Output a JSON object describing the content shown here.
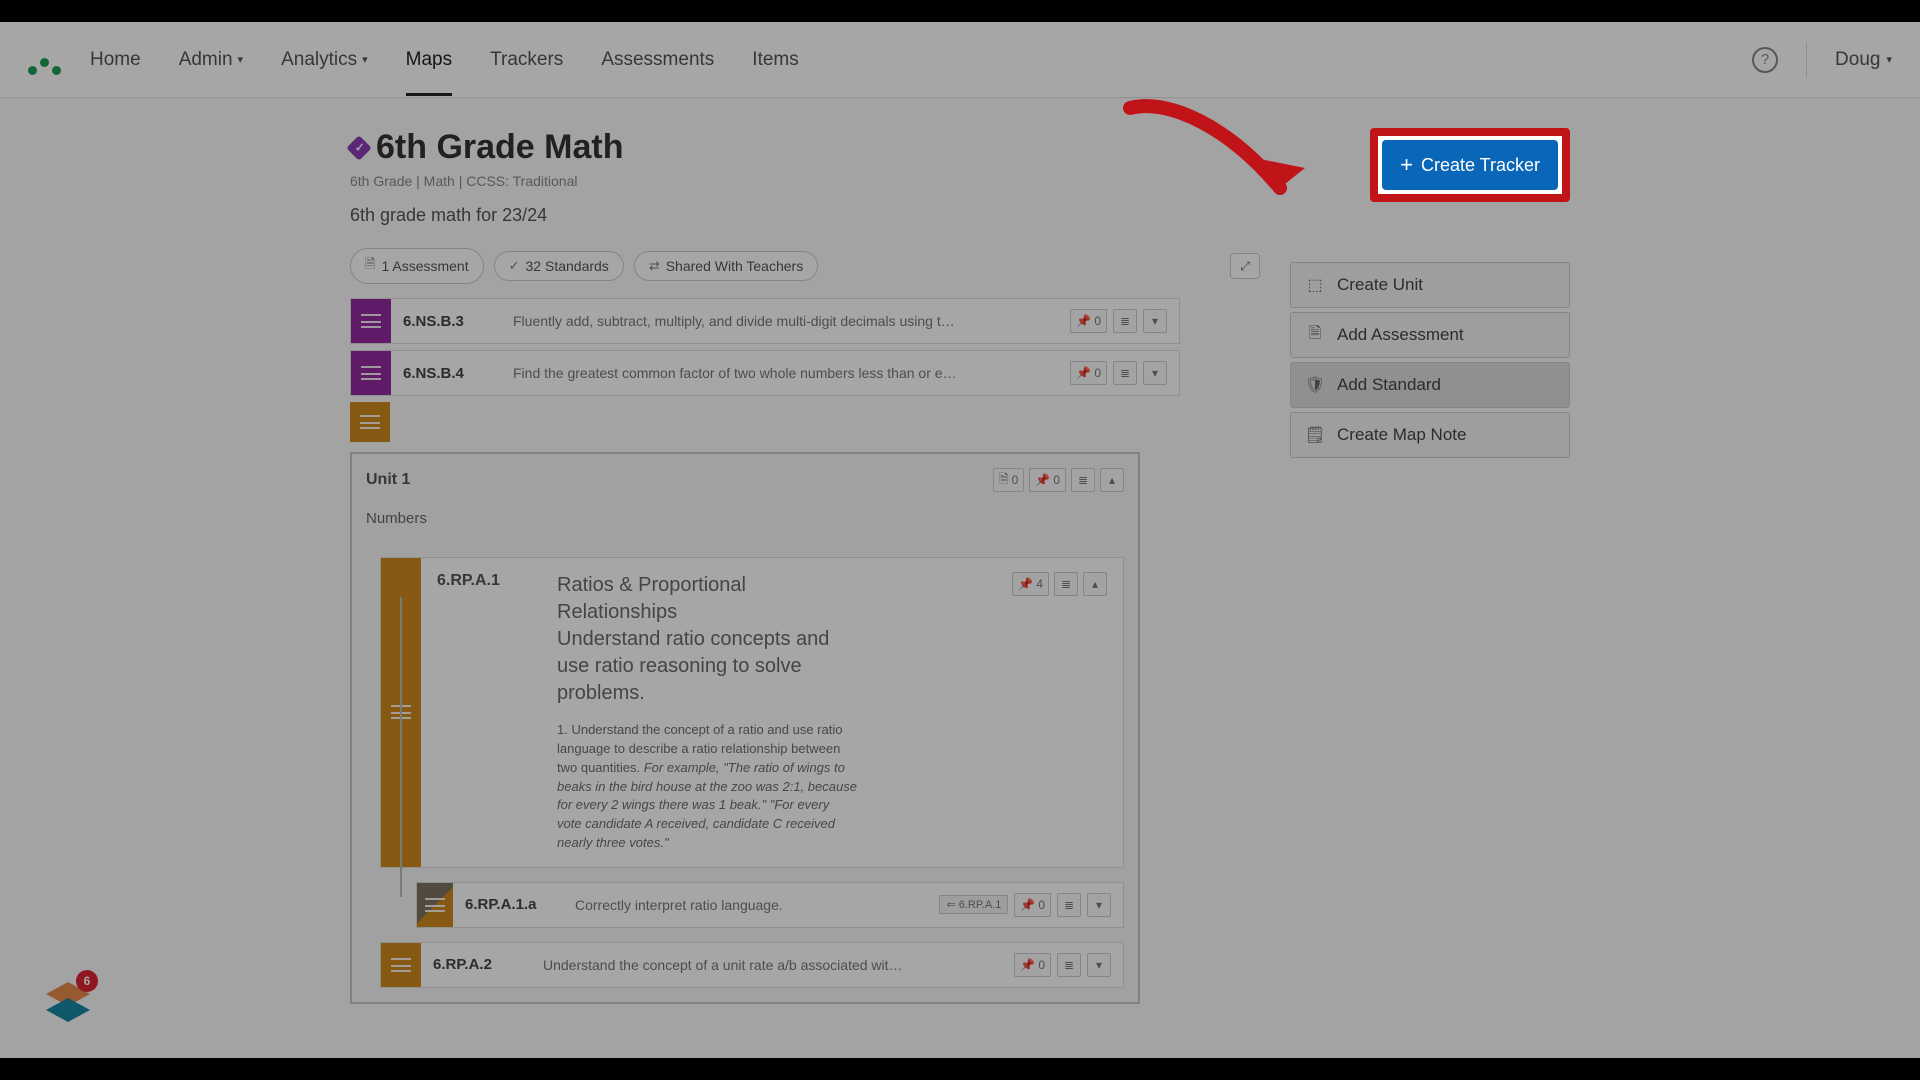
{
  "nav": {
    "home": "Home",
    "admin": "Admin",
    "analytics": "Analytics",
    "maps": "Maps",
    "trackers": "Trackers",
    "assessments": "Assessments",
    "items": "Items",
    "user": "Doug"
  },
  "page": {
    "title": "6th Grade Math",
    "crumbs": "6th Grade  |  Math  |  CCSS: Traditional",
    "subtitle": "6th grade math for 23/24"
  },
  "chips": {
    "assessment": "1 Assessment",
    "standards": "32 Standards",
    "shared": "Shared With Teachers"
  },
  "create_tracker": "Create Tracker",
  "actions": {
    "create_unit": "Create Unit",
    "add_assessment": "Add Assessment",
    "add_standard": "Add Standard",
    "create_note": "Create Map Note"
  },
  "std1": {
    "code": "6.NS.B.3",
    "desc": "Fluently add, subtract, multiply, and divide multi-digit decimals using t…",
    "count": "0"
  },
  "std2": {
    "code": "6.NS.B.4",
    "desc": "Find the greatest common factor of two whole numbers less than or e…",
    "count": "0"
  },
  "unit": {
    "title": "Unit 1",
    "subtitle": "Numbers",
    "doc_count": "0",
    "pin_count": "0"
  },
  "rp1": {
    "code": "6.RP.A.1",
    "heading": "Ratios & Proportional Relationships\nUnderstand ratio concepts and use ratio reasoning to solve problems.",
    "body_lead": "1. Understand the concept of a ratio and use ratio language to describe a ratio relationship between two quantities. ",
    "body_ex": "For example, \"The ratio of wings to beaks in the bird house at the zoo was 2:1, because for every 2 wings there was 1 beak.\" \"For every vote candidate A received, candidate C received nearly three votes.\"",
    "count": "4"
  },
  "rp1a": {
    "code": "6.RP.A.1.a",
    "desc": "Correctly interpret ratio language.",
    "tag": "⇐ 6.RP.A.1",
    "count": "0"
  },
  "rp2": {
    "code": "6.RP.A.2",
    "desc": "Understand the concept of a unit rate a/b associated wit…",
    "count": "0"
  },
  "floater_badge": "6"
}
